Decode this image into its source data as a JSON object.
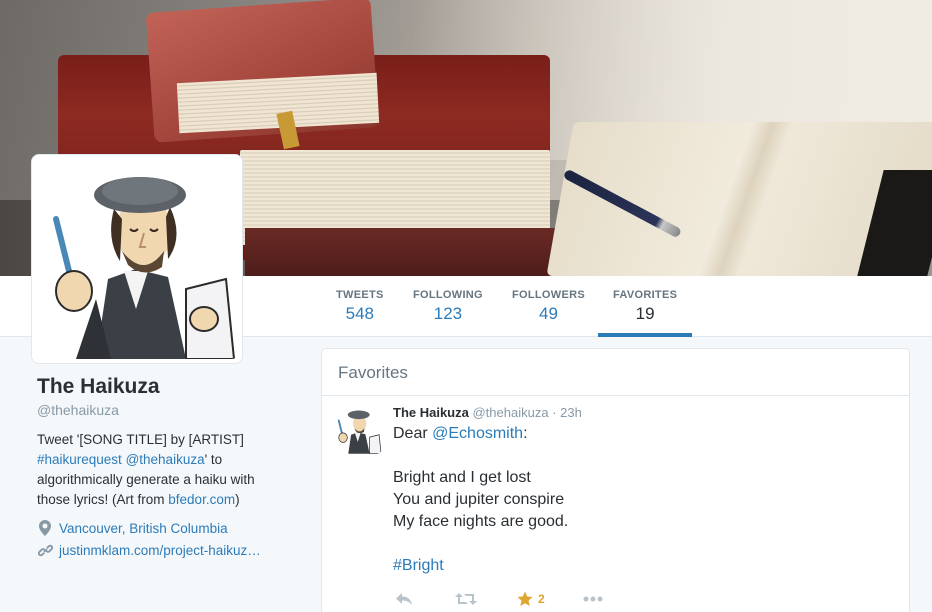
{
  "profile": {
    "name": "The Haikuza",
    "handle": "@thehaikuza",
    "bio_part1": "Tweet '[SONG TITLE] by [ARTIST]",
    "bio_hashtag": "#haikurequest",
    "bio_mention": "@thehaikuza",
    "bio_part2": "' to algorithmically generate a haiku with those lyrics! (Art from ",
    "bio_link": "bfedor.com",
    "bio_part3": ")",
    "location": "Vancouver, British Columbia",
    "website": "justinmklam.com/project-haikuz…"
  },
  "stats": [
    {
      "label": "TWEETS",
      "value": "548"
    },
    {
      "label": "FOLLOWING",
      "value": "123"
    },
    {
      "label": "FOLLOWERS",
      "value": "49"
    },
    {
      "label": "FAVORITES",
      "value": "19"
    }
  ],
  "panel": {
    "title": "Favorites"
  },
  "tweet": {
    "name": "The Haikuza",
    "handle": "@thehaikuza",
    "separator": "·",
    "time": "23h",
    "greeting": "Dear ",
    "mention": "@Echosmith",
    "greeting_end": ":",
    "line1": "Bright and I get lost",
    "line2": "You and jupiter conspire",
    "line3": "My face nights are good.",
    "hashtag": "#Bright",
    "favorite_count": "2"
  },
  "icons": {
    "reply": "reply-icon",
    "retweet": "retweet-icon",
    "favorite": "star-icon",
    "more": "more-icon",
    "location": "location-pin-icon",
    "website": "link-icon"
  },
  "colors": {
    "accent": "#2b7bb9",
    "favorite": "#e0a431",
    "muted": "#8899a6"
  }
}
